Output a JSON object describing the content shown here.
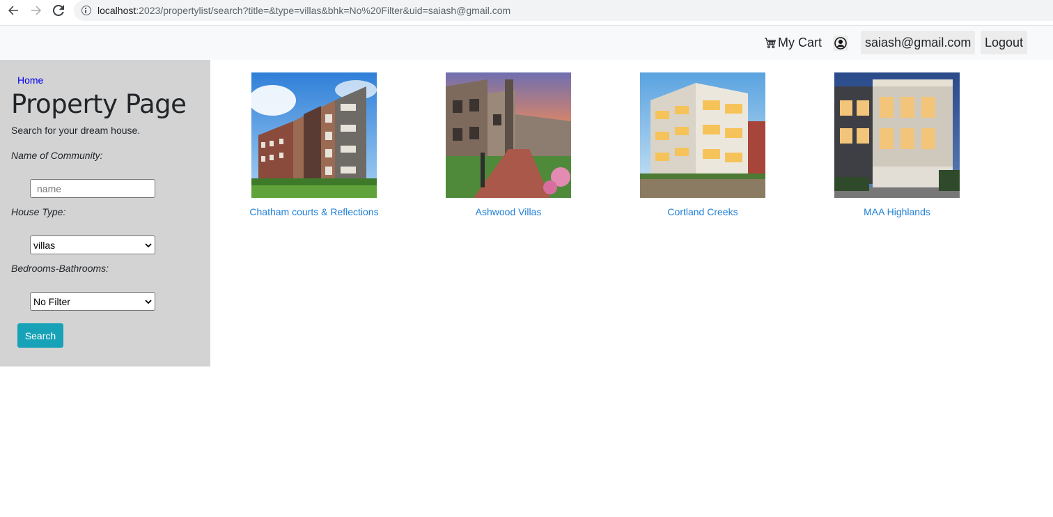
{
  "browser": {
    "url_host": "localhost",
    "url_rest": ":2023/propertylist/search?title=&type=villas&bhk=No%20Filter&uid=saiash@gmail.com"
  },
  "navbar": {
    "cart_label": "My Cart",
    "user_email": "saiash@gmail.com",
    "logout_label": "Logout"
  },
  "sidebar": {
    "home_link": "Home",
    "title": "Property Page",
    "subtitle": "Search for your dream house.",
    "community_label": "Name of Community:",
    "community_placeholder": "name",
    "community_value": "",
    "house_type_label": "House Type:",
    "house_type_selected": "villas",
    "bedrooms_label": "Bedrooms-Bathrooms:",
    "bedrooms_selected": "No Filter",
    "search_button": "Search"
  },
  "properties": [
    {
      "name": "Chatham courts & Reflections"
    },
    {
      "name": "Ashwood Villas"
    },
    {
      "name": "Cortland Creeks"
    },
    {
      "name": "MAA Highlands"
    }
  ],
  "colors": {
    "sidebar_bg": "#d3d3d3",
    "accent_button": "#17a2b8",
    "link_blue": "#1e7fd6"
  }
}
